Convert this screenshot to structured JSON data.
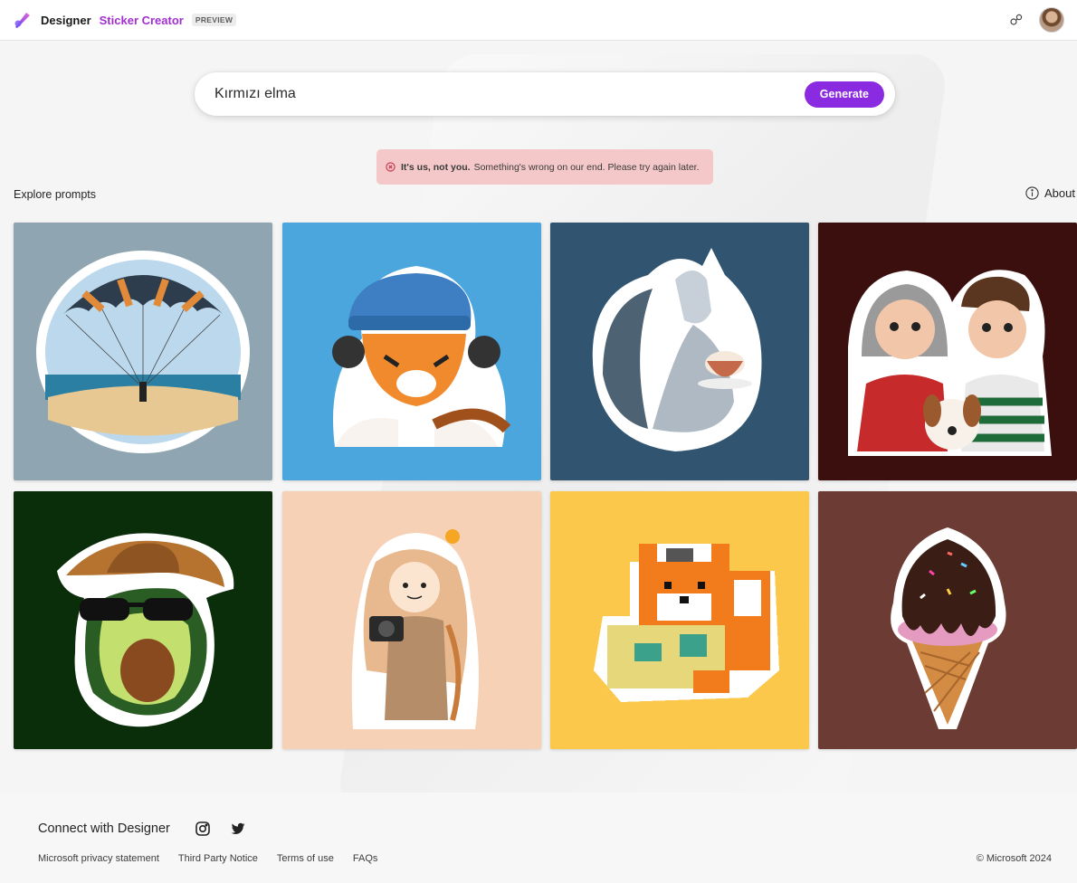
{
  "header": {
    "brand": "Designer",
    "product": "Sticker Creator",
    "badge": "PREVIEW"
  },
  "prompt": {
    "value": "Kırmızı elma",
    "generate_label": "Generate"
  },
  "error": {
    "bold": "It's us, not you.",
    "message": "Something's wrong on our end. Please try again later.",
    "color": "#f4c8c8"
  },
  "explore": {
    "title": "Explore prompts",
    "about_label": "About"
  },
  "stickers": [
    {
      "name": "parachute",
      "bg": "#8fa6b2"
    },
    {
      "name": "tiger-headphones",
      "bg": "#4aa6dc"
    },
    {
      "name": "dragon-teacup",
      "bg": "#315570"
    },
    {
      "name": "grandparents-dog",
      "bg": "#3a0f0d"
    },
    {
      "name": "avocado-cowboy",
      "bg": "#0b2e0a"
    },
    {
      "name": "photographer-girl",
      "bg": "#f7d1b5"
    },
    {
      "name": "pixel-fox",
      "bg": "#fbc84b"
    },
    {
      "name": "ice-cream",
      "bg": "#6b3b34"
    }
  ],
  "footer": {
    "connect": "Connect with Designer",
    "links": [
      "Microsoft privacy statement",
      "Third Party Notice",
      "Terms of use",
      "FAQs"
    ],
    "copyright": "© Microsoft 2024"
  },
  "colors": {
    "accent": "#8a2be2",
    "brand_purple": "#a12fd0"
  }
}
